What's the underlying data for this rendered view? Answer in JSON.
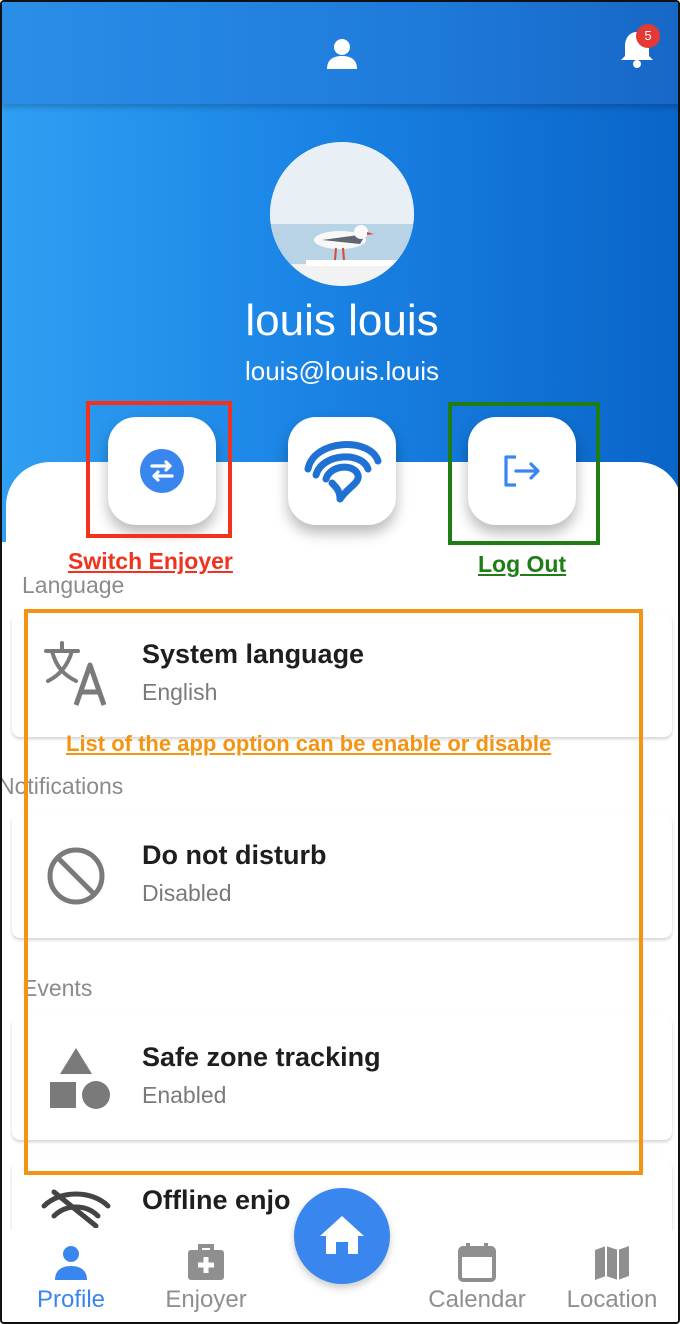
{
  "header": {
    "notification_count": "5",
    "icons": [
      "person-icon",
      "bell-icon"
    ]
  },
  "profile": {
    "name": "louis louis",
    "email": "louis@louis.louis",
    "avatar_description": "seagull-photo"
  },
  "actions": [
    {
      "name": "switch-enjoyer-button",
      "icon": "swap-arrows-icon"
    },
    {
      "name": "app-logo-button",
      "icon": "app-logo-icon"
    },
    {
      "name": "log-out-button",
      "icon": "logout-icon"
    }
  ],
  "annotations": {
    "switch_label": "Switch Enjoyer",
    "logout_label": "Log Out",
    "options_label": "List of the app option can be enable or disable",
    "colors": {
      "red": "#f0321e",
      "green": "#1e7d14",
      "orange": "#f39412"
    }
  },
  "sections": {
    "language": {
      "label": "Language",
      "title": "System language",
      "value": "English",
      "icon": "translate-icon"
    },
    "notifications": {
      "label": "Notifications",
      "title": "Do not disturb",
      "value": "Disabled",
      "icon": "block-icon"
    },
    "events": {
      "label": "Events",
      "title": "Safe zone tracking",
      "value": "Enabled",
      "icon": "shapes-icon"
    },
    "offline": {
      "title": "Offline enjo",
      "icon": "wifi-off-icon"
    }
  },
  "nav": {
    "profile": "Profile",
    "enjoyer": "Enjoyer",
    "calendar": "Calendar",
    "location": "Location",
    "active": "Profile",
    "active_color": "#3a86ef",
    "inactive_color": "#8f8f8f"
  },
  "colors": {
    "primary": "#1a84e5",
    "accent_blue": "#3a86ef",
    "badge_red": "#e53935"
  }
}
